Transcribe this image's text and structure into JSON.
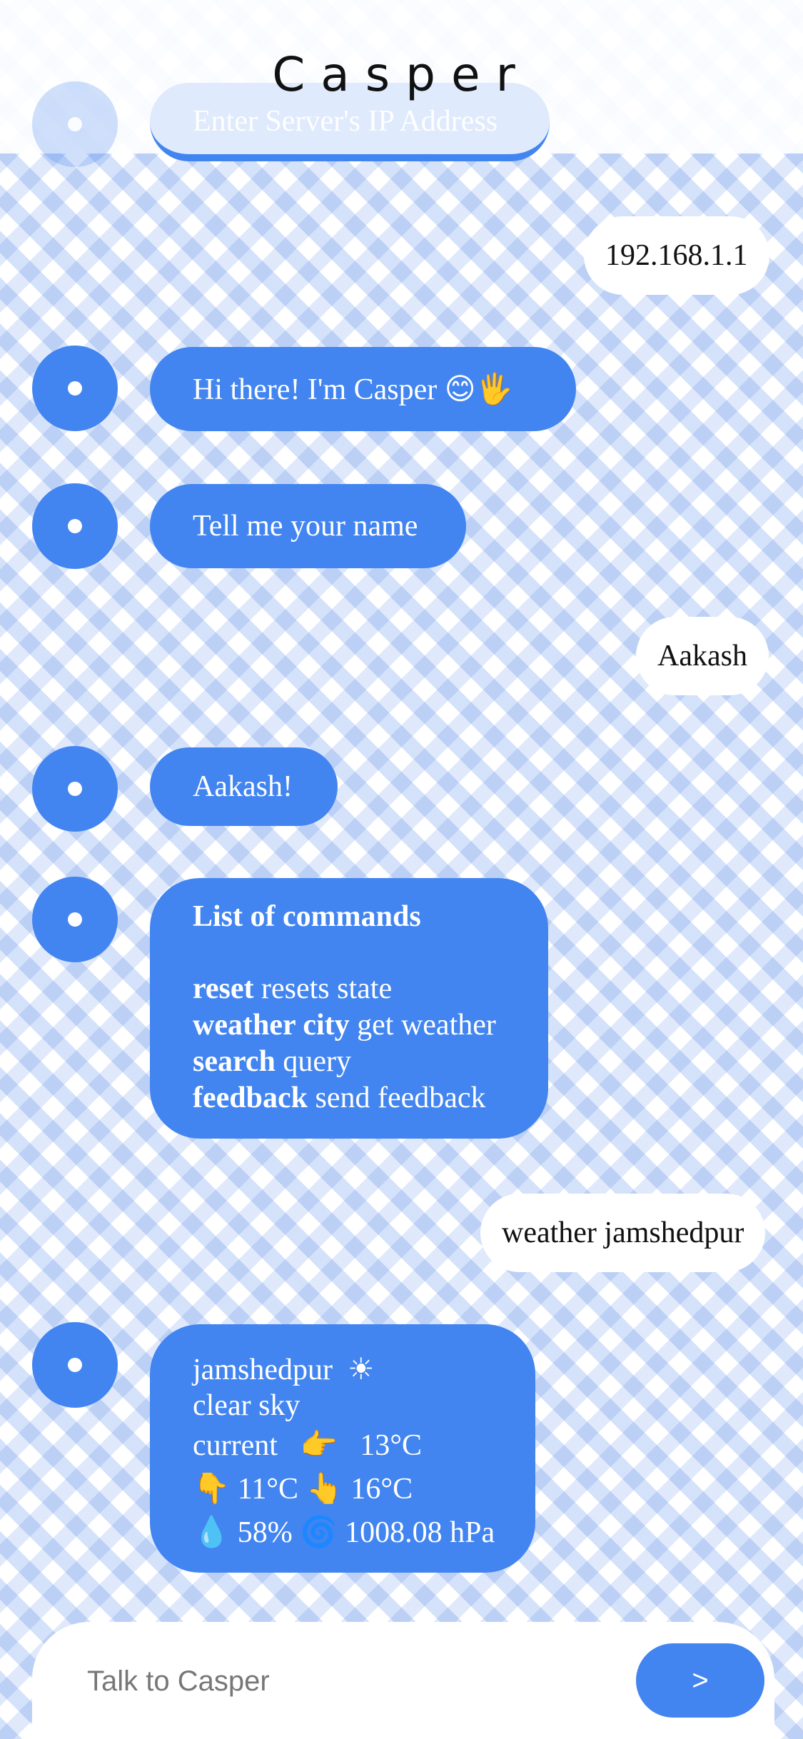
{
  "app": {
    "title": "Casper"
  },
  "server": {
    "placeholder": "Enter Server's IP Address"
  },
  "messages": {
    "ip": "192.168.1.1",
    "greeting": "Hi there! I'm Casper",
    "greeting_emoji": "😊🖐",
    "ask_name": "Tell me your name",
    "user_name": "Aakash",
    "name_reply": "Aakash!",
    "commands": {
      "title": "List of commands",
      "items": [
        {
          "cmd": "reset",
          "desc": "resets state"
        },
        {
          "cmd": "weather city",
          "desc": "get weather"
        },
        {
          "cmd": "search",
          "desc": "query"
        },
        {
          "cmd": "feedback",
          "desc": "send feedback"
        }
      ]
    },
    "user_weather": "weather jamshedpur",
    "weather": {
      "city": "jamshedpur",
      "sky_icon": "☀",
      "description": "clear sky",
      "current_label": "current",
      "current_icon": "👉",
      "current": "13°C",
      "min_icon": "👇",
      "min": "11°C",
      "max_icon": "👆",
      "max": "16°C",
      "humidity_icon": "💧",
      "humidity": "58%",
      "pressure_icon": "🌀",
      "pressure": "1008.08 hPa"
    }
  },
  "input": {
    "placeholder": "Talk to Casper",
    "send_label": ">"
  },
  "colors": {
    "accent": "#4285f0",
    "user_bubble": "#ffffff"
  }
}
